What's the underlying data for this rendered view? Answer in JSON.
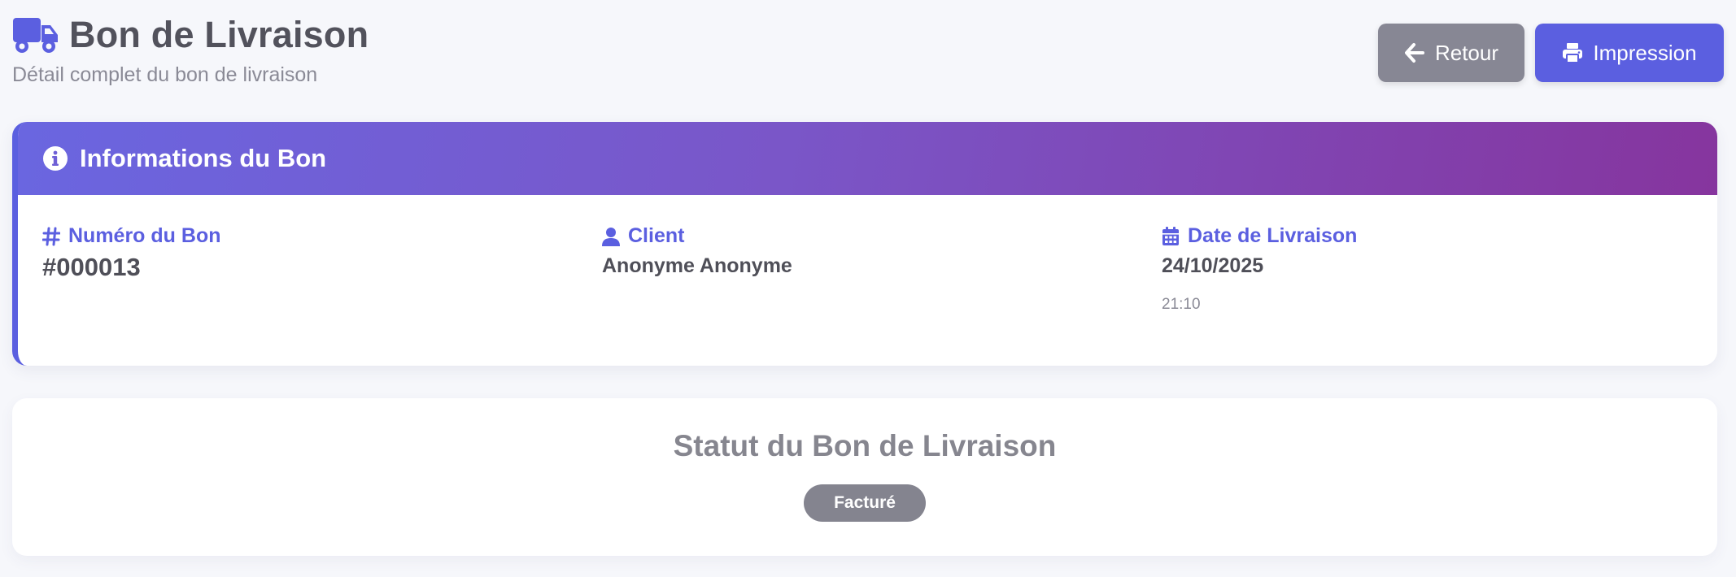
{
  "header": {
    "title": "Bon de Livraison",
    "subtitle": "Détail complet du bon de livraison",
    "back_label": "Retour",
    "print_label": "Impression"
  },
  "info_card": {
    "title": "Informations du Bon",
    "fields": [
      {
        "label": "Numéro du Bon",
        "value": "#000013",
        "icon": "hash-icon"
      },
      {
        "label": "Client",
        "value": "Anonyme Anonyme",
        "icon": "user-icon"
      },
      {
        "label": "Date de Livraison",
        "value": "24/10/2025",
        "time": "21:10",
        "icon": "calendar-icon"
      }
    ]
  },
  "status_card": {
    "title": "Statut du Bon de Livraison",
    "badge": "Facturé"
  },
  "colors": {
    "accent": "#5b5fe0",
    "gradient_start": "#6a66e0",
    "gradient_end": "#86359e",
    "muted_button": "#878794",
    "badge": "#84848f"
  }
}
